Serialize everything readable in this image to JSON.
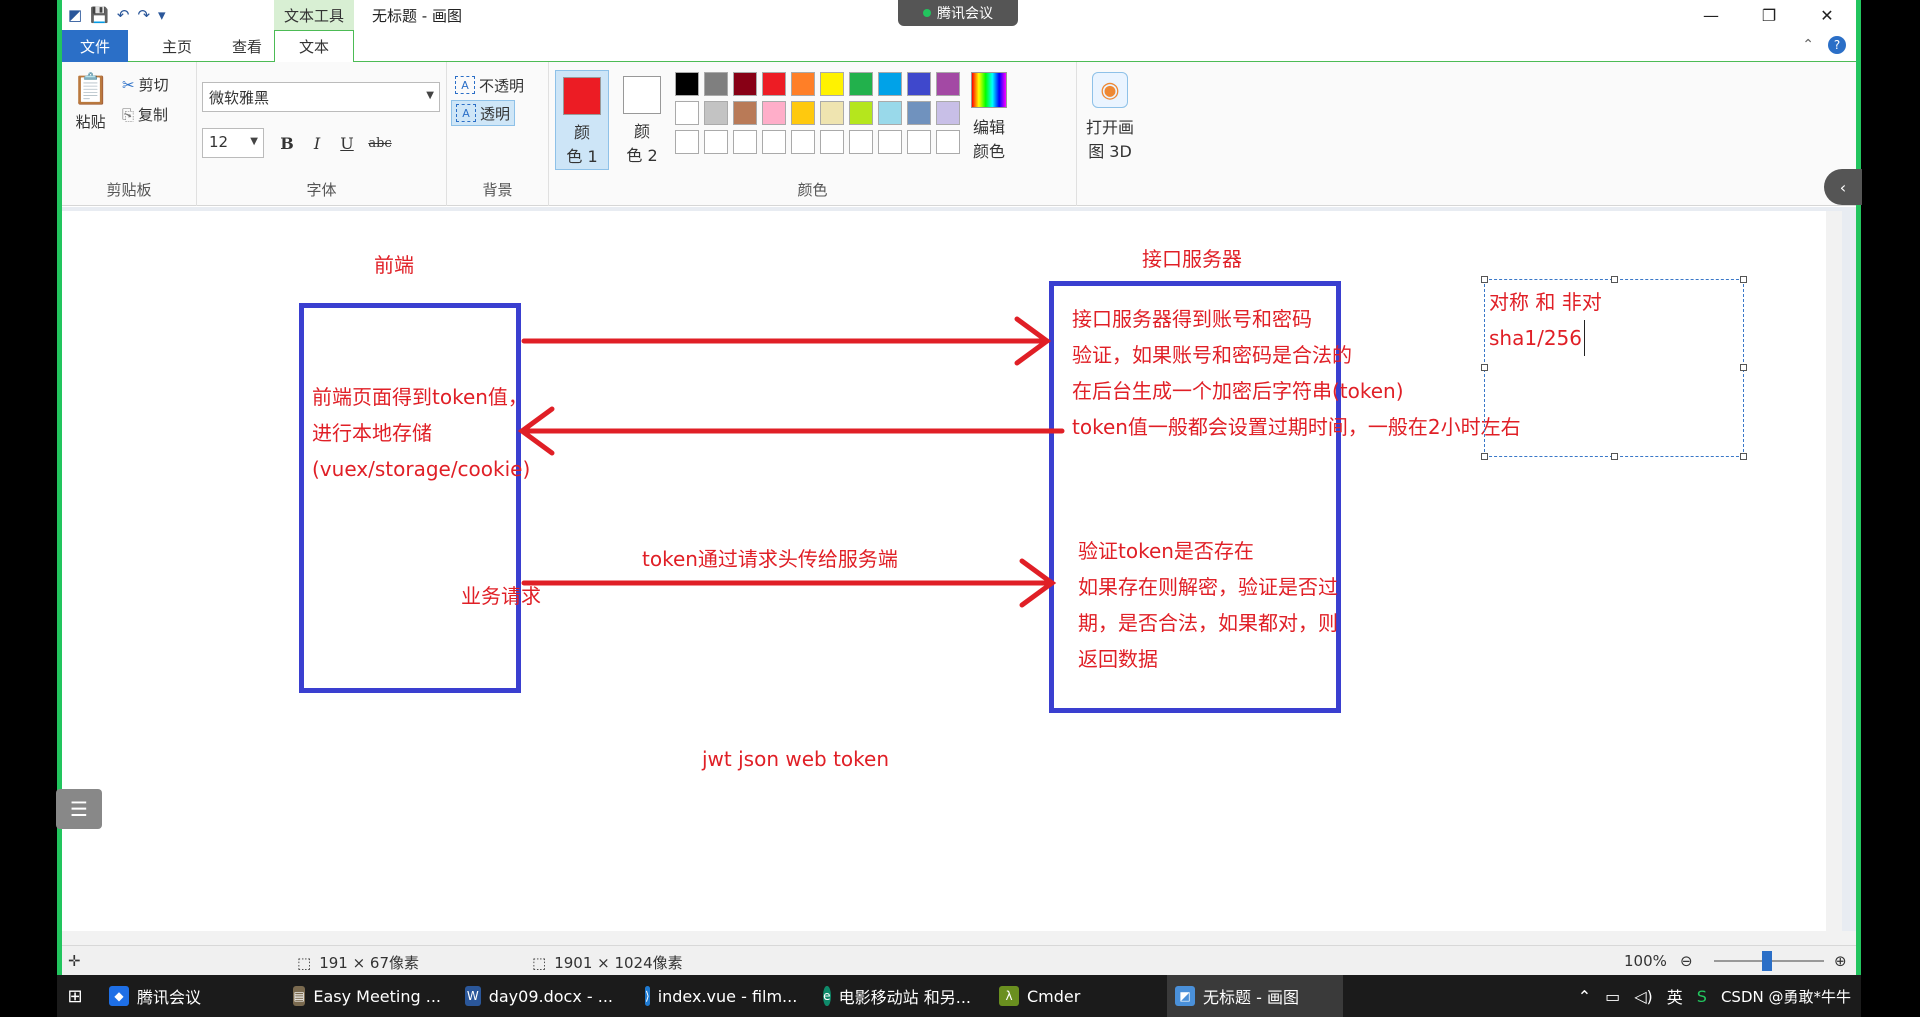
{
  "window": {
    "context_tab": "文本工具",
    "title": "无标题 - 画图",
    "meeting_chip": "腾讯会议",
    "minimize": "—",
    "restore": "❐",
    "close": "✕"
  },
  "ribbon_tabs": {
    "file": "文件",
    "home": "主页",
    "view": "查看",
    "text": "文本"
  },
  "clipboard": {
    "paste": "粘贴",
    "cut": "剪切",
    "copy": "复制",
    "group_label": "剪贴板"
  },
  "font": {
    "family": "微软雅黑",
    "size": "12",
    "bold": "B",
    "italic": "I",
    "underline": "U",
    "strike": "abc",
    "group_label": "字体"
  },
  "background": {
    "opaque": "不透明",
    "transparent": "透明",
    "group_label": "背景"
  },
  "colors": {
    "color1_label_line1": "颜",
    "color1_label_line2": "色 1",
    "color2_label_line1": "颜",
    "color2_label_line2": "色 2",
    "color1_value": "#ec1c24",
    "color2_value": "#ffffff",
    "edit_line1": "编辑",
    "edit_line2": "颜色",
    "group_label": "颜色",
    "palette": [
      "#000000",
      "#7f7f7f",
      "#880015",
      "#ed1c24",
      "#ff7f27",
      "#fff200",
      "#22b14c",
      "#00a2e8",
      "#3f48cc",
      "#a349a4",
      "#ffffff",
      "#c3c3c3",
      "#b97a57",
      "#ffaec9",
      "#ffc90e",
      "#efe4b0",
      "#b5e61d",
      "#99d9ea",
      "#7092be",
      "#c8bfe7",
      "#ffffff",
      "#ffffff",
      "#ffffff",
      "#ffffff",
      "#ffffff",
      "#ffffff",
      "#ffffff",
      "#ffffff",
      "#ffffff",
      "#ffffff"
    ]
  },
  "paint3d": {
    "line1": "打开画",
    "line2": "图 3D"
  },
  "canvas": {
    "label_frontend": "前端",
    "label_server": "接口服务器",
    "frontend_text": [
      "前端页面得到token值，",
      "进行本地存储",
      "(vuex/storage/cookie)"
    ],
    "business_request": "业务请求",
    "server_text_1": [
      "接口服务器得到账号和密码",
      "验证，如果账号和密码是合法的",
      "在后台生成一个加密后字符串(token)",
      "token值一般都会设置过期时间，一般在2小时左右"
    ],
    "header_note": "token通过请求头传给服务端",
    "server_text_2": [
      "验证token是否存在",
      "如果存在则解密，验证是否过",
      "期，是否合法，如果都对，则",
      "返回数据"
    ],
    "jwt": "jwt  json web token",
    "selection_text": [
      "对称  和  非对",
      "sha1/256"
    ],
    "arrow_color": "#e01f26",
    "box_color": "#3a3fd0"
  },
  "status": {
    "selection_size": "191 × 67像素",
    "canvas_size": "1901 × 1024像素",
    "zoom": "100%"
  },
  "taskbar": {
    "items": [
      "腾讯会议",
      "Easy Meeting ...",
      "day09.docx - ...",
      "index.vue - film...",
      "电影移动站 和另...",
      "Cmder",
      "无标题 - 画图"
    ],
    "ime": "英",
    "watermark": "CSDN @勇敢*牛牛"
  }
}
